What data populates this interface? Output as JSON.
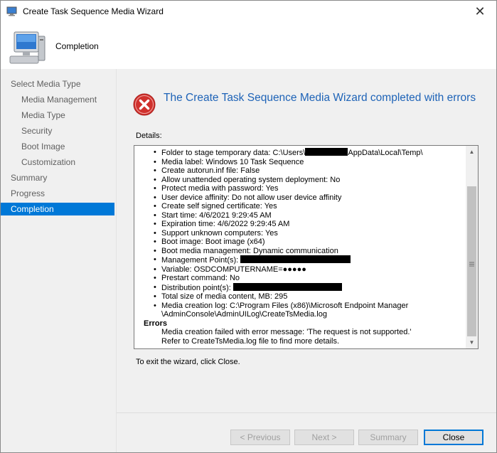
{
  "window": {
    "title": "Create Task Sequence Media Wizard",
    "close_glyph": "✕"
  },
  "header": {
    "title": "Completion",
    "icon": "computer-icon"
  },
  "sidebar": {
    "items": [
      {
        "label": "Select Media Type",
        "level": "top",
        "active": false
      },
      {
        "label": "Media Management",
        "level": "sub",
        "active": false
      },
      {
        "label": "Media Type",
        "level": "sub",
        "active": false
      },
      {
        "label": "Security",
        "level": "sub",
        "active": false
      },
      {
        "label": "Boot Image",
        "level": "sub",
        "active": false
      },
      {
        "label": "Customization",
        "level": "sub",
        "active": false
      },
      {
        "label": "Summary",
        "level": "top",
        "active": false
      },
      {
        "label": "Progress",
        "level": "top",
        "active": false
      },
      {
        "label": "Completion",
        "level": "top",
        "active": true
      }
    ]
  },
  "main": {
    "headline": "The Create Task Sequence Media Wizard completed with errors",
    "details_label": "Details:",
    "details": {
      "folder_prefix": "Folder to stage temporary data: C:\\Users\\",
      "folder_suffix": "AppData\\Local\\Temp\\",
      "media_label": "Media label: Windows 10 Task Sequence",
      "autorun": "Create autorun.inf file: False",
      "unattended": "Allow unattended operating system deployment: No",
      "protect": "Protect media with password: Yes",
      "affinity": "User device affinity: Do not allow user device affinity",
      "selfsigned": "Create self signed certificate: Yes",
      "start": "Start time: 4/6/2021 9:29:45 AM",
      "expiration": "Expiration time: 4/6/2022 9:29:45 AM",
      "unknown": "Support unknown computers: Yes",
      "boot_image": "Boot image: Boot image (x64)",
      "boot_mgmt": "Boot media management: Dynamic communication",
      "mp": "Management Point(s):",
      "variable": "Variable: OSDCOMPUTERNAME=●●●●●",
      "prestart": "Prestart command: No",
      "dp": "Distribution point(s):",
      "size": "Total size of media content, MB:  295",
      "log_1": "Media creation log: C:\\Program Files (x86)\\Microsoft Endpoint Manager",
      "log_2": "\\AdminConsole\\AdminUILog\\CreateTsMedia.log",
      "errors_heading": "Errors",
      "error_1": "Media creation failed with error message: 'The request is not supported.'",
      "error_2": "Refer to CreateTsMedia.log file to find more details."
    },
    "exit_text": "To exit the wizard, click Close."
  },
  "footer": {
    "previous": "< Previous",
    "next": "Next >",
    "summary": "Summary",
    "close": "Close"
  },
  "colors": {
    "accent": "#0078d7",
    "headline": "#1e63b7",
    "error": "#d0312d"
  }
}
